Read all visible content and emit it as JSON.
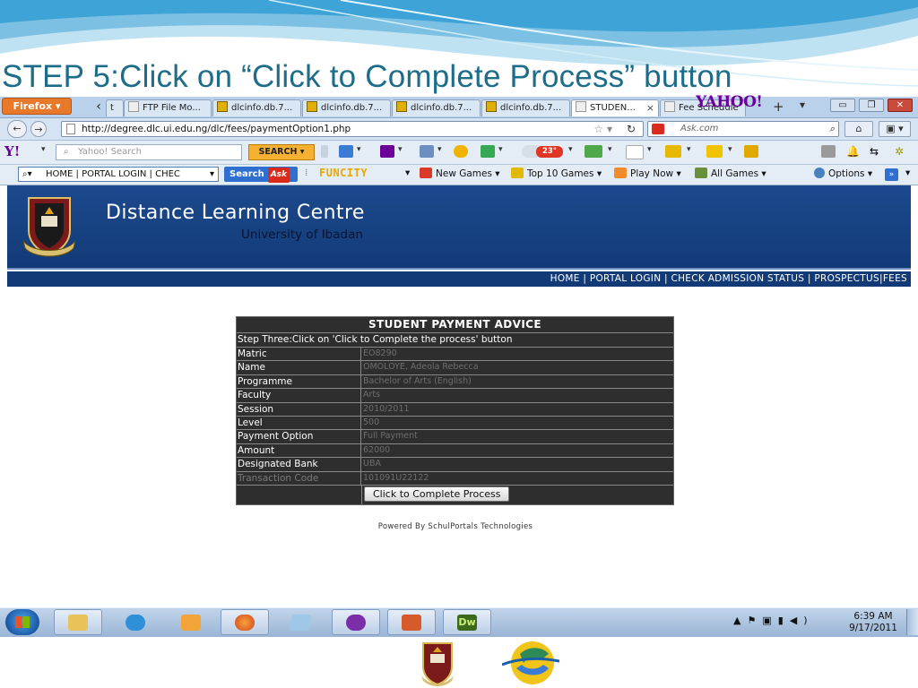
{
  "slide": {
    "title": "STEP 5:Click on “Click to Complete Process” button"
  },
  "browser": {
    "app_button": "Firefox ▾",
    "tabs": [
      {
        "label": "t",
        "icon": "page-icon"
      },
      {
        "label": "FTP File Mo...",
        "icon": "page-icon"
      },
      {
        "label": "dlcinfo.db.7...",
        "icon": "dlc-icon"
      },
      {
        "label": "dlcinfo.db.7...",
        "icon": "dlc-icon"
      },
      {
        "label": "dlcinfo.db.7...",
        "icon": "dlc-icon"
      },
      {
        "label": "dlcinfo.db.7...",
        "icon": "dlc-icon"
      },
      {
        "label": "STUDEN...",
        "icon": "page-icon",
        "active": true,
        "close": "×"
      },
      {
        "label": "Fee Schedule",
        "icon": "page-icon"
      }
    ],
    "brand_logo": "YAHOO!",
    "url": "http://degree.dlc.ui.edu.ng/dlc/fees/paymentOption1.php",
    "search_engine_placeholder": "Ask.com",
    "yahoo_toolbar": {
      "logo": "Y!",
      "search_placeholder": "Yahoo! Search",
      "search_button": "SEARCH",
      "weather": "23°"
    },
    "ask_toolbar": {
      "search_value": "HOME | PORTAL LOGIN | CHEC",
      "search_button": "Search",
      "ask_label": "Ask",
      "funcity": "FUNCITY",
      "items": [
        "New Games ▾",
        "Top 10 Games ▾",
        "Play Now ▾",
        "All Games ▾"
      ],
      "options": "Options ▾",
      "more": "»"
    }
  },
  "site": {
    "name": "Distance Learning Centre",
    "subtitle": "University of Ibadan",
    "nav": [
      "HOME",
      "PORTAL LOGIN",
      "CHECK ADMISSION STATUS",
      "PROSPECTUS",
      "FEES"
    ],
    "nav_sep": " | "
  },
  "advice": {
    "title": "STUDENT PAYMENT ADVICE",
    "step": "Step Three:Click on 'Click to Complete the process' button",
    "rows": [
      {
        "label": "Matric",
        "value": "EO8290"
      },
      {
        "label": "Name",
        "value": "OMOLOYE, Adeola Rebecca"
      },
      {
        "label": "Programme",
        "value": "Bachelor of Arts (English)"
      },
      {
        "label": "Faculty",
        "value": "Arts"
      },
      {
        "label": "Session",
        "value": "2010/2011"
      },
      {
        "label": "Level",
        "value": "500"
      },
      {
        "label": "Payment Option",
        "value": "Full Payment"
      },
      {
        "label": "Amount",
        "value": "62000"
      },
      {
        "label": "Designated Bank",
        "value": "UBA"
      },
      {
        "label": "Transaction Code",
        "value": "101091U22122"
      }
    ],
    "button": "Click to Complete Process",
    "powered": "Powered By SchulPortals Technologies"
  },
  "taskbar": {
    "time": "6:39 AM",
    "date": "9/17/2011",
    "apps": [
      "explorer",
      "ie",
      "media-player",
      "firefox",
      "notepad",
      "yahoo-messenger",
      "powerpoint",
      "dreamweaver"
    ],
    "dw_label": "Dw"
  }
}
